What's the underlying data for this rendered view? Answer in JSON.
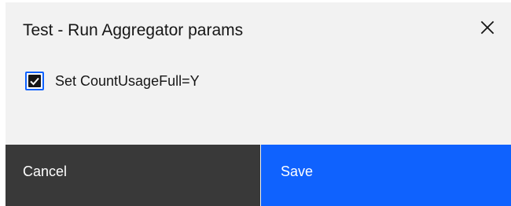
{
  "modal": {
    "title": "Test - Run Aggregator params",
    "close_icon": "close-icon"
  },
  "options": {
    "count_usage_full": {
      "label": "Set CountUsageFull=Y",
      "checked": true
    }
  },
  "footer": {
    "cancel_label": "Cancel",
    "save_label": "Save"
  },
  "colors": {
    "dialog_background": "#f2f2f2",
    "cancel_background": "#393939",
    "primary_accent": "#0f62fe",
    "text": "#161616"
  }
}
